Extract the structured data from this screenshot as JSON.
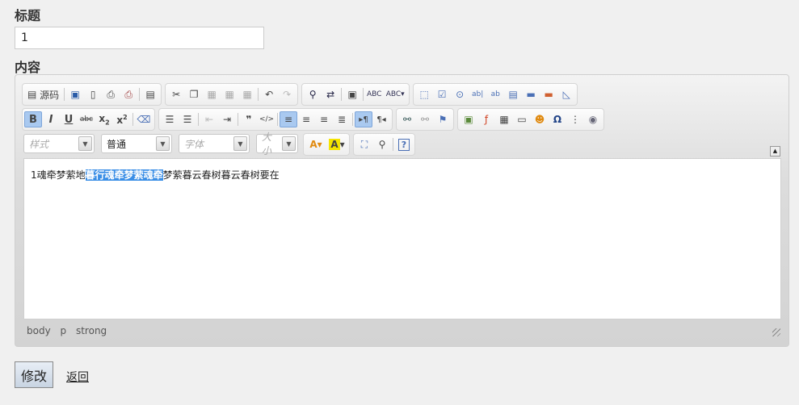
{
  "form": {
    "title_label": "标题",
    "title_value": "1",
    "content_label": "内容",
    "submit_label": "修改",
    "back_label": "返回"
  },
  "toolbar": {
    "source_label": "源码",
    "style_combo": "样式",
    "format_combo": "普通",
    "font_combo": "字体",
    "size_combo": "大小"
  },
  "editor": {
    "text_before": "1魂牵梦萦地",
    "text_selected": "暮行魂牵梦萦魂牵",
    "text_after": "梦萦暮云春树暮云春树要在"
  },
  "pathbar": {
    "items": [
      "body",
      "p",
      "strong"
    ]
  },
  "colors": {
    "selection": "#3a8ee6",
    "active_button": "#a9c9f0"
  }
}
